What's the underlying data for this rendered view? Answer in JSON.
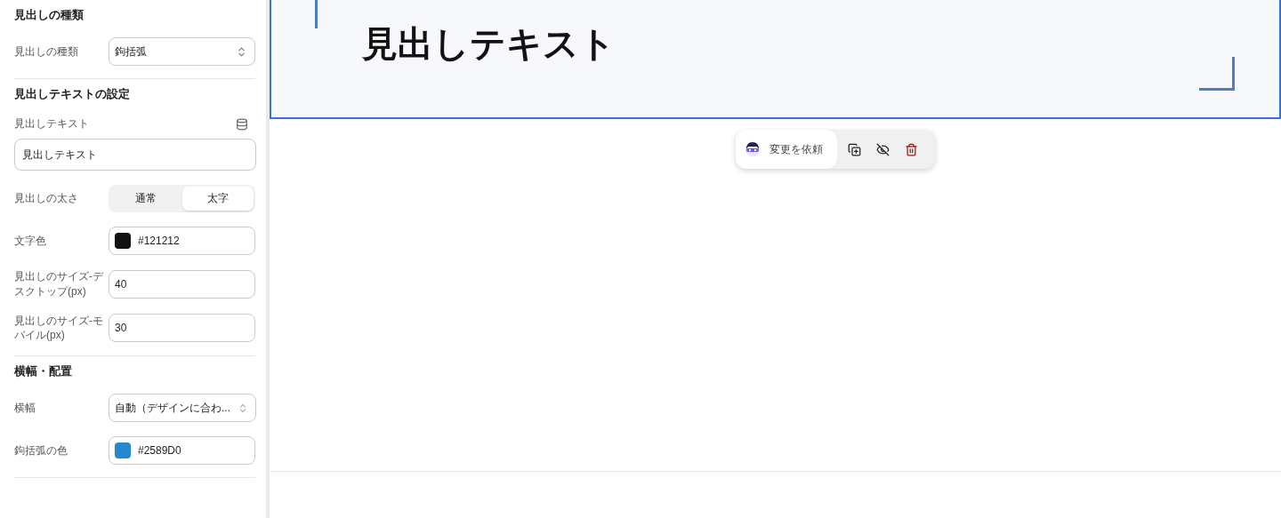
{
  "sidebar": {
    "sections": [
      {
        "title": "見出しの種類",
        "fields": [
          {
            "kind": "select",
            "label": "見出しの種類",
            "value": "鉤括弧"
          }
        ]
      },
      {
        "title": "見出しテキストの設定",
        "fields": [
          {
            "kind": "text",
            "label": "見出しテキスト",
            "value": "見出しテキスト"
          },
          {
            "kind": "segmented",
            "label": "見出しの太さ",
            "options": [
              {
                "label": "通常",
                "selected": false
              },
              {
                "label": "太字",
                "selected": true
              }
            ]
          },
          {
            "kind": "color",
            "label": "文字色",
            "value": "#121212",
            "color": "#121212"
          },
          {
            "kind": "number",
            "label": "見出しのサイズ-デスクトップ(px)",
            "value": "40"
          },
          {
            "kind": "number",
            "label": "見出しのサイズ-モバイル(px)",
            "value": "30"
          }
        ]
      },
      {
        "title": "横幅・配置",
        "fields": [
          {
            "kind": "select",
            "label": "横幅",
            "value": "自動（デザインに合わ..."
          },
          {
            "kind": "color",
            "label": "鉤括弧の色",
            "value": "#2589D0",
            "color": "#2589d0"
          }
        ]
      }
    ]
  },
  "preview": {
    "heading": "見出しテキスト",
    "toolbar": {
      "request_label": "変更を依頼"
    }
  }
}
